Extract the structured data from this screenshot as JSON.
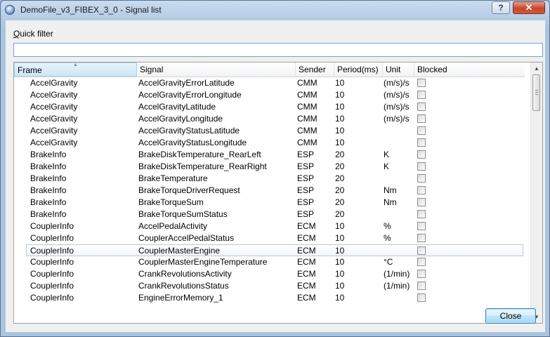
{
  "window": {
    "title": "DemoFile_v3_FIBEX_3_0 - Signal list",
    "help_label": "?",
    "close_label": "✕",
    "icon": "app-shield-icon"
  },
  "quick_filter": {
    "label_mnemonic": "Q",
    "label_rest": "uick filter",
    "value": ""
  },
  "table": {
    "columns": [
      "Frame",
      "Signal",
      "Sender",
      "Period(ms)",
      "Unit",
      "Blocked"
    ],
    "sorted_column": "Frame",
    "rows": [
      {
        "frame": "AccelGravity",
        "signal": "AccelGravityErrorLatitude",
        "sender": "CMM",
        "period": "10",
        "unit": "(m/s)/s"
      },
      {
        "frame": "AccelGravity",
        "signal": "AccelGravityErrorLongitude",
        "sender": "CMM",
        "period": "10",
        "unit": "(m/s)/s"
      },
      {
        "frame": "AccelGravity",
        "signal": "AccelGravityLatitude",
        "sender": "CMM",
        "period": "10",
        "unit": "(m/s)/s"
      },
      {
        "frame": "AccelGravity",
        "signal": "AccelGravityLongitude",
        "sender": "CMM",
        "period": "10",
        "unit": "(m/s)/s"
      },
      {
        "frame": "AccelGravity",
        "signal": "AccelGravityStatusLatitude",
        "sender": "CMM",
        "period": "10",
        "unit": ""
      },
      {
        "frame": "AccelGravity",
        "signal": "AccelGravityStatusLongitude",
        "sender": "CMM",
        "period": "10",
        "unit": ""
      },
      {
        "frame": "BrakeInfo",
        "signal": "BrakeDiskTemperature_RearLeft",
        "sender": "ESP",
        "period": "20",
        "unit": "K"
      },
      {
        "frame": "BrakeInfo",
        "signal": "BrakeDiskTemperature_RearRight",
        "sender": "ESP",
        "period": "20",
        "unit": "K"
      },
      {
        "frame": "BrakeInfo",
        "signal": "BrakeTemperature",
        "sender": "ESP",
        "period": "20",
        "unit": ""
      },
      {
        "frame": "BrakeInfo",
        "signal": "BrakeTorqueDriverRequest",
        "sender": "ESP",
        "period": "20",
        "unit": "Nm"
      },
      {
        "frame": "BrakeInfo",
        "signal": "BrakeTorqueSum",
        "sender": "ESP",
        "period": "20",
        "unit": "Nm"
      },
      {
        "frame": "BrakeInfo",
        "signal": "BrakeTorqueSumStatus",
        "sender": "ESP",
        "period": "20",
        "unit": ""
      },
      {
        "frame": "CouplerInfo",
        "signal": "AccelPedalActivity",
        "sender": "ECM",
        "period": "10",
        "unit": "%"
      },
      {
        "frame": "CouplerInfo",
        "signal": "CouplerAccelPedalStatus",
        "sender": "ECM",
        "period": "10",
        "unit": "%"
      },
      {
        "frame": "CouplerInfo",
        "signal": "CouplerMasterEngine",
        "sender": "ECM",
        "period": "10",
        "unit": "",
        "selected": true
      },
      {
        "frame": "CouplerInfo",
        "signal": "CouplerMasterEngineTemperature",
        "sender": "ECM",
        "period": "10",
        "unit": "°C"
      },
      {
        "frame": "CouplerInfo",
        "signal": "CrankRevolutionsActivity",
        "sender": "ECM",
        "period": "10",
        "unit": "(1/min)"
      },
      {
        "frame": "CouplerInfo",
        "signal": "CrankRevolutionsStatus",
        "sender": "ECM",
        "period": "10",
        "unit": "(1/min)"
      },
      {
        "frame": "CouplerInfo",
        "signal": "EngineErrorMemory_1",
        "sender": "ECM",
        "period": "10",
        "unit": ""
      }
    ]
  },
  "buttons": {
    "close": "Close"
  }
}
